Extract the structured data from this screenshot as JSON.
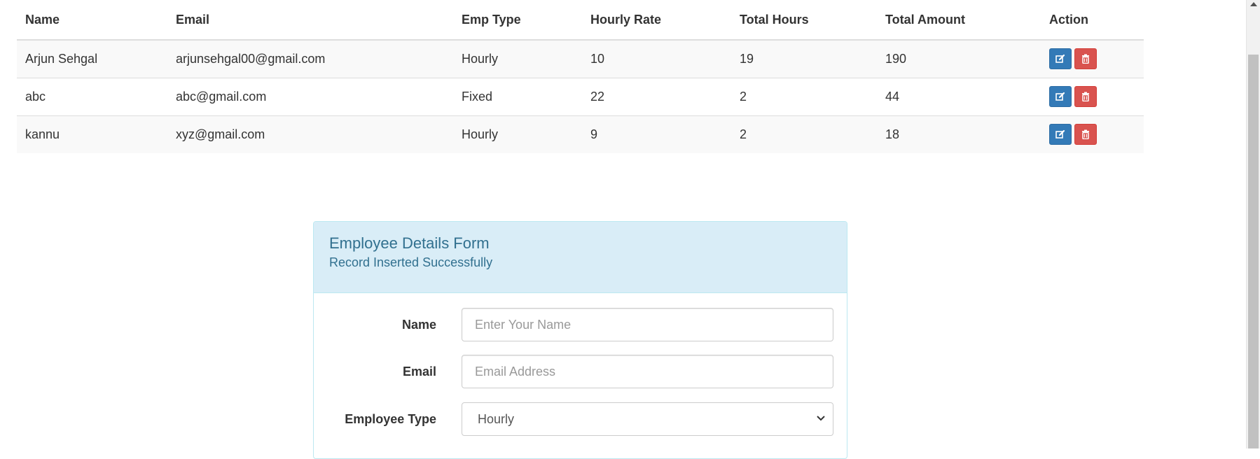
{
  "table": {
    "headers": [
      "Name",
      "Email",
      "Emp Type",
      "Hourly Rate",
      "Total Hours",
      "Total Amount",
      "Action"
    ],
    "rows": [
      {
        "name": "Arjun Sehgal",
        "email": "arjunsehgal00@gmail.com",
        "emp_type": "Hourly",
        "hourly_rate": "10",
        "total_hours": "19",
        "total_amount": "190"
      },
      {
        "name": "abc",
        "email": "abc@gmail.com",
        "emp_type": "Fixed",
        "hourly_rate": "22",
        "total_hours": "2",
        "total_amount": "44"
      },
      {
        "name": "kannu",
        "email": "xyz@gmail.com",
        "emp_type": "Hourly",
        "hourly_rate": "9",
        "total_hours": "2",
        "total_amount": "18"
      }
    ],
    "actions": {
      "edit_icon": "edit-icon",
      "delete_icon": "trash-icon"
    }
  },
  "form": {
    "title": "Employee Details Form",
    "status_message": "Record Inserted Successfully",
    "name_label": "Name",
    "name_placeholder": "Enter Your Name",
    "email_label": "Email",
    "email_placeholder": "Email Address",
    "employee_type_label": "Employee Type",
    "employee_type_selected": "Hourly"
  },
  "colors": {
    "edit_button": "#337ab7",
    "delete_button": "#d9534f",
    "panel_heading_bg": "#d9edf7",
    "panel_heading_text": "#31708f"
  }
}
